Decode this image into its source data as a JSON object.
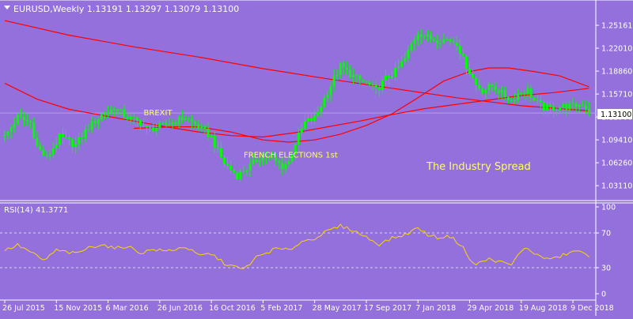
{
  "window": {
    "menu_icon": "triangle-down-icon",
    "title": "EURUSD,Weekly  1.13191 1.13297 1.13079 1.13100",
    "watermark": "The Industry Spread"
  },
  "colors": {
    "background": "#9370DB",
    "candle": "#00FF00",
    "ma": "#FF0000",
    "rsi": "#FFD700",
    "text": "#FFFFFF",
    "annotation": "#FFFF66",
    "level_lines": "#D8D0F0",
    "price_grid": "#B5A0E6"
  },
  "chart_data": [
    {
      "type": "candlestick",
      "symbol": "EURUSD",
      "timeframe": "Weekly",
      "ohlc_last": {
        "open": 1.13191,
        "high": 1.13297,
        "low": 1.13079,
        "close": 1.131
      },
      "current_price_label": "1.13100",
      "y_ticks": [
        "1.25161",
        "1.22010",
        "1.18860",
        "1.15710",
        "1.12560",
        "1.09410",
        "1.06260",
        "1.03110"
      ],
      "ylim": [
        1.015,
        1.2625
      ],
      "x_ticks": [
        {
          "label": "26 Jul 2015",
          "index": 0
        },
        {
          "label": "15 Nov 2015",
          "index": 16
        },
        {
          "label": "6 Mar 2016",
          "index": 32
        },
        {
          "label": "26 Jun 2016",
          "index": 48
        },
        {
          "label": "16 Oct 2016",
          "index": 64
        },
        {
          "label": "5 Feb 2017",
          "index": 80
        },
        {
          "label": "28 May 2017",
          "index": 96
        },
        {
          "label": "17 Sep 2017",
          "index": 112
        },
        {
          "label": "7 Jan 2018",
          "index": 128
        },
        {
          "label": "29 Apr 2018",
          "index": 144
        },
        {
          "label": "19 Aug 2018",
          "index": 160
        },
        {
          "label": "9 Dec 2018",
          "index": 176
        }
      ],
      "price_path": [
        {
          "index": 0,
          "price": 1.098
        },
        {
          "index": 4,
          "price": 1.125
        },
        {
          "index": 8,
          "price": 1.118
        },
        {
          "index": 10,
          "price": 1.085
        },
        {
          "index": 13,
          "price": 1.068
        },
        {
          "index": 17,
          "price": 1.098
        },
        {
          "index": 22,
          "price": 1.087
        },
        {
          "index": 26,
          "price": 1.112
        },
        {
          "index": 30,
          "price": 1.128
        },
        {
          "index": 34,
          "price": 1.138
        },
        {
          "index": 38,
          "price": 1.125
        },
        {
          "index": 42,
          "price": 1.118
        },
        {
          "index": 44,
          "price": 1.108
        },
        {
          "index": 48,
          "price": 1.112
        },
        {
          "index": 52,
          "price": 1.118
        },
        {
          "index": 56,
          "price": 1.125
        },
        {
          "index": 60,
          "price": 1.112
        },
        {
          "index": 64,
          "price": 1.098
        },
        {
          "index": 66,
          "price": 1.078
        },
        {
          "index": 68,
          "price": 1.062
        },
        {
          "index": 72,
          "price": 1.045
        },
        {
          "index": 76,
          "price": 1.058
        },
        {
          "index": 80,
          "price": 1.074
        },
        {
          "index": 84,
          "price": 1.064
        },
        {
          "index": 86,
          "price": 1.058
        },
        {
          "index": 88,
          "price": 1.064
        },
        {
          "index": 90,
          "price": 1.09
        },
        {
          "index": 93,
          "price": 1.118
        },
        {
          "index": 96,
          "price": 1.124
        },
        {
          "index": 98,
          "price": 1.142
        },
        {
          "index": 102,
          "price": 1.178
        },
        {
          "index": 104,
          "price": 1.195
        },
        {
          "index": 106,
          "price": 1.188
        },
        {
          "index": 109,
          "price": 1.178
        },
        {
          "index": 112,
          "price": 1.172
        },
        {
          "index": 115,
          "price": 1.162
        },
        {
          "index": 118,
          "price": 1.178
        },
        {
          "index": 121,
          "price": 1.188
        },
        {
          "index": 124,
          "price": 1.205
        },
        {
          "index": 126,
          "price": 1.225
        },
        {
          "index": 128,
          "price": 1.242
        },
        {
          "index": 131,
          "price": 1.235
        },
        {
          "index": 134,
          "price": 1.232
        },
        {
          "index": 137,
          "price": 1.232
        },
        {
          "index": 140,
          "price": 1.228
        },
        {
          "index": 142,
          "price": 1.205
        },
        {
          "index": 144,
          "price": 1.188
        },
        {
          "index": 146,
          "price": 1.17
        },
        {
          "index": 148,
          "price": 1.162
        },
        {
          "index": 151,
          "price": 1.168
        },
        {
          "index": 154,
          "price": 1.158
        },
        {
          "index": 157,
          "price": 1.148
        },
        {
          "index": 159,
          "price": 1.158
        },
        {
          "index": 162,
          "price": 1.162
        },
        {
          "index": 164,
          "price": 1.148
        },
        {
          "index": 167,
          "price": 1.138
        },
        {
          "index": 170,
          "price": 1.138
        },
        {
          "index": 173,
          "price": 1.14
        },
        {
          "index": 176,
          "price": 1.14
        },
        {
          "index": 179,
          "price": 1.144
        },
        {
          "index": 181,
          "price": 1.133
        }
      ],
      "moving_averages": [
        {
          "color": "#FF0000",
          "points": [
            {
              "index": 0,
              "price": 1.258
            },
            {
              "index": 20,
              "price": 1.238
            },
            {
              "index": 40,
              "price": 1.222
            },
            {
              "index": 60,
              "price": 1.208
            },
            {
              "index": 80,
              "price": 1.192
            },
            {
              "index": 100,
              "price": 1.178
            },
            {
              "index": 120,
              "price": 1.165
            },
            {
              "index": 140,
              "price": 1.152
            },
            {
              "index": 160,
              "price": 1.141
            },
            {
              "index": 181,
              "price": 1.134
            }
          ]
        },
        {
          "color": "#FF0000",
          "points": [
            {
              "index": 0,
              "price": 1.172
            },
            {
              "index": 10,
              "price": 1.15
            },
            {
              "index": 20,
              "price": 1.136
            },
            {
              "index": 30,
              "price": 1.128
            },
            {
              "index": 40,
              "price": 1.12
            },
            {
              "index": 50,
              "price": 1.112
            },
            {
              "index": 60,
              "price": 1.105
            },
            {
              "index": 70,
              "price": 1.1
            },
            {
              "index": 80,
              "price": 1.098
            },
            {
              "index": 90,
              "price": 1.104
            },
            {
              "index": 100,
              "price": 1.112
            },
            {
              "index": 110,
              "price": 1.12
            },
            {
              "index": 120,
              "price": 1.129
            },
            {
              "index": 130,
              "price": 1.137
            },
            {
              "index": 140,
              "price": 1.143
            },
            {
              "index": 150,
              "price": 1.149
            },
            {
              "index": 160,
              "price": 1.155
            },
            {
              "index": 170,
              "price": 1.159
            },
            {
              "index": 181,
              "price": 1.165
            }
          ]
        },
        {
          "color": "#FF0000",
          "points": [
            {
              "index": 40,
              "price": 1.11
            },
            {
              "index": 52,
              "price": 1.112
            },
            {
              "index": 60,
              "price": 1.112
            },
            {
              "index": 70,
              "price": 1.105
            },
            {
              "index": 80,
              "price": 1.094
            },
            {
              "index": 88,
              "price": 1.091
            },
            {
              "index": 96,
              "price": 1.094
            },
            {
              "index": 104,
              "price": 1.102
            },
            {
              "index": 112,
              "price": 1.114
            },
            {
              "index": 120,
              "price": 1.13
            },
            {
              "index": 128,
              "price": 1.152
            },
            {
              "index": 136,
              "price": 1.175
            },
            {
              "index": 144,
              "price": 1.188
            },
            {
              "index": 150,
              "price": 1.193
            },
            {
              "index": 156,
              "price": 1.193
            },
            {
              "index": 164,
              "price": 1.188
            },
            {
              "index": 172,
              "price": 1.182
            },
            {
              "index": 181,
              "price": 1.167
            }
          ]
        }
      ],
      "annotations": [
        {
          "text": "BREXIT",
          "index": 44,
          "price": 1.128
        },
        {
          "text": "FRENCH ELECTIONS 1st",
          "index": 75,
          "price": 1.07
        }
      ]
    },
    {
      "type": "line",
      "name": "RSI(14)",
      "label": "RSI(14) 41.3771",
      "value": 41.3771,
      "y_ticks": [
        "100",
        "70",
        "30",
        "0"
      ],
      "levels": [
        70,
        30
      ],
      "ylim": [
        0,
        100
      ],
      "rsi_path": [
        {
          "index": 0,
          "value": 50
        },
        {
          "index": 4,
          "value": 56
        },
        {
          "index": 8,
          "value": 48
        },
        {
          "index": 12,
          "value": 38
        },
        {
          "index": 16,
          "value": 50
        },
        {
          "index": 22,
          "value": 46
        },
        {
          "index": 26,
          "value": 53
        },
        {
          "index": 30,
          "value": 57
        },
        {
          "index": 34,
          "value": 52
        },
        {
          "index": 38,
          "value": 55
        },
        {
          "index": 42,
          "value": 47
        },
        {
          "index": 46,
          "value": 51
        },
        {
          "index": 50,
          "value": 49
        },
        {
          "index": 56,
          "value": 54
        },
        {
          "index": 60,
          "value": 44
        },
        {
          "index": 64,
          "value": 46
        },
        {
          "index": 68,
          "value": 35
        },
        {
          "index": 72,
          "value": 30
        },
        {
          "index": 74,
          "value": 28
        },
        {
          "index": 78,
          "value": 42
        },
        {
          "index": 84,
          "value": 52
        },
        {
          "index": 88,
          "value": 50
        },
        {
          "index": 92,
          "value": 60
        },
        {
          "index": 96,
          "value": 64
        },
        {
          "index": 100,
          "value": 72
        },
        {
          "index": 104,
          "value": 78
        },
        {
          "index": 108,
          "value": 73
        },
        {
          "index": 112,
          "value": 65
        },
        {
          "index": 116,
          "value": 57
        },
        {
          "index": 120,
          "value": 64
        },
        {
          "index": 124,
          "value": 68
        },
        {
          "index": 128,
          "value": 76
        },
        {
          "index": 131,
          "value": 68
        },
        {
          "index": 134,
          "value": 65
        },
        {
          "index": 138,
          "value": 66
        },
        {
          "index": 142,
          "value": 54
        },
        {
          "index": 144,
          "value": 38
        },
        {
          "index": 146,
          "value": 34
        },
        {
          "index": 150,
          "value": 40
        },
        {
          "index": 154,
          "value": 36
        },
        {
          "index": 157,
          "value": 33
        },
        {
          "index": 160,
          "value": 50
        },
        {
          "index": 162,
          "value": 52
        },
        {
          "index": 166,
          "value": 42
        },
        {
          "index": 170,
          "value": 40
        },
        {
          "index": 174,
          "value": 46
        },
        {
          "index": 178,
          "value": 50
        },
        {
          "index": 181,
          "value": 41
        }
      ]
    }
  ]
}
